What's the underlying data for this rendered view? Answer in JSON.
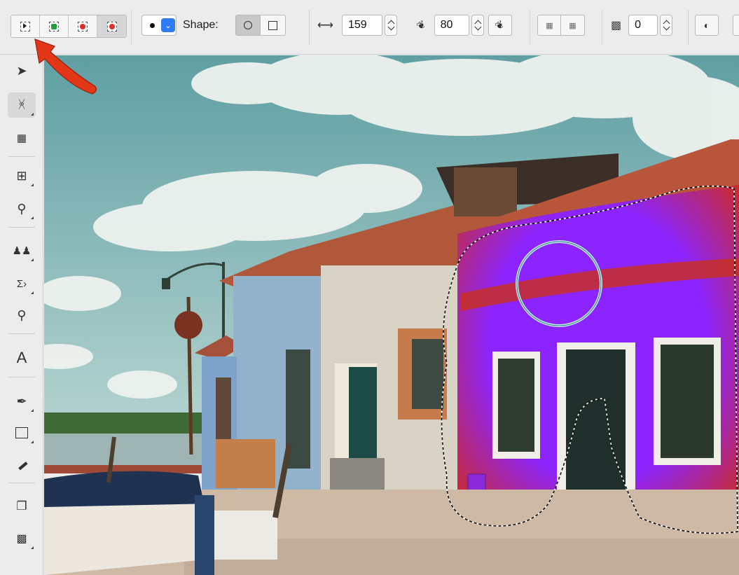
{
  "toolbar": {
    "selection_modes": [
      {
        "name": "replace",
        "icon": "select-replace-icon",
        "color": "#222222"
      },
      {
        "name": "add",
        "icon": "select-add-icon",
        "color": "#1fa23c"
      },
      {
        "name": "subtract",
        "icon": "select-subtract-icon",
        "color": "#e02b2b"
      },
      {
        "name": "intersect",
        "icon": "select-intersect-icon",
        "color": "#e02b2b"
      }
    ],
    "shape_label": "Shape:",
    "size_value": "159",
    "feather_value": "80",
    "opacity_value": "0"
  },
  "colors": {
    "accent": "#2f7bf5",
    "arrow": "#e23617",
    "selected_fill": "#8f22ff"
  }
}
